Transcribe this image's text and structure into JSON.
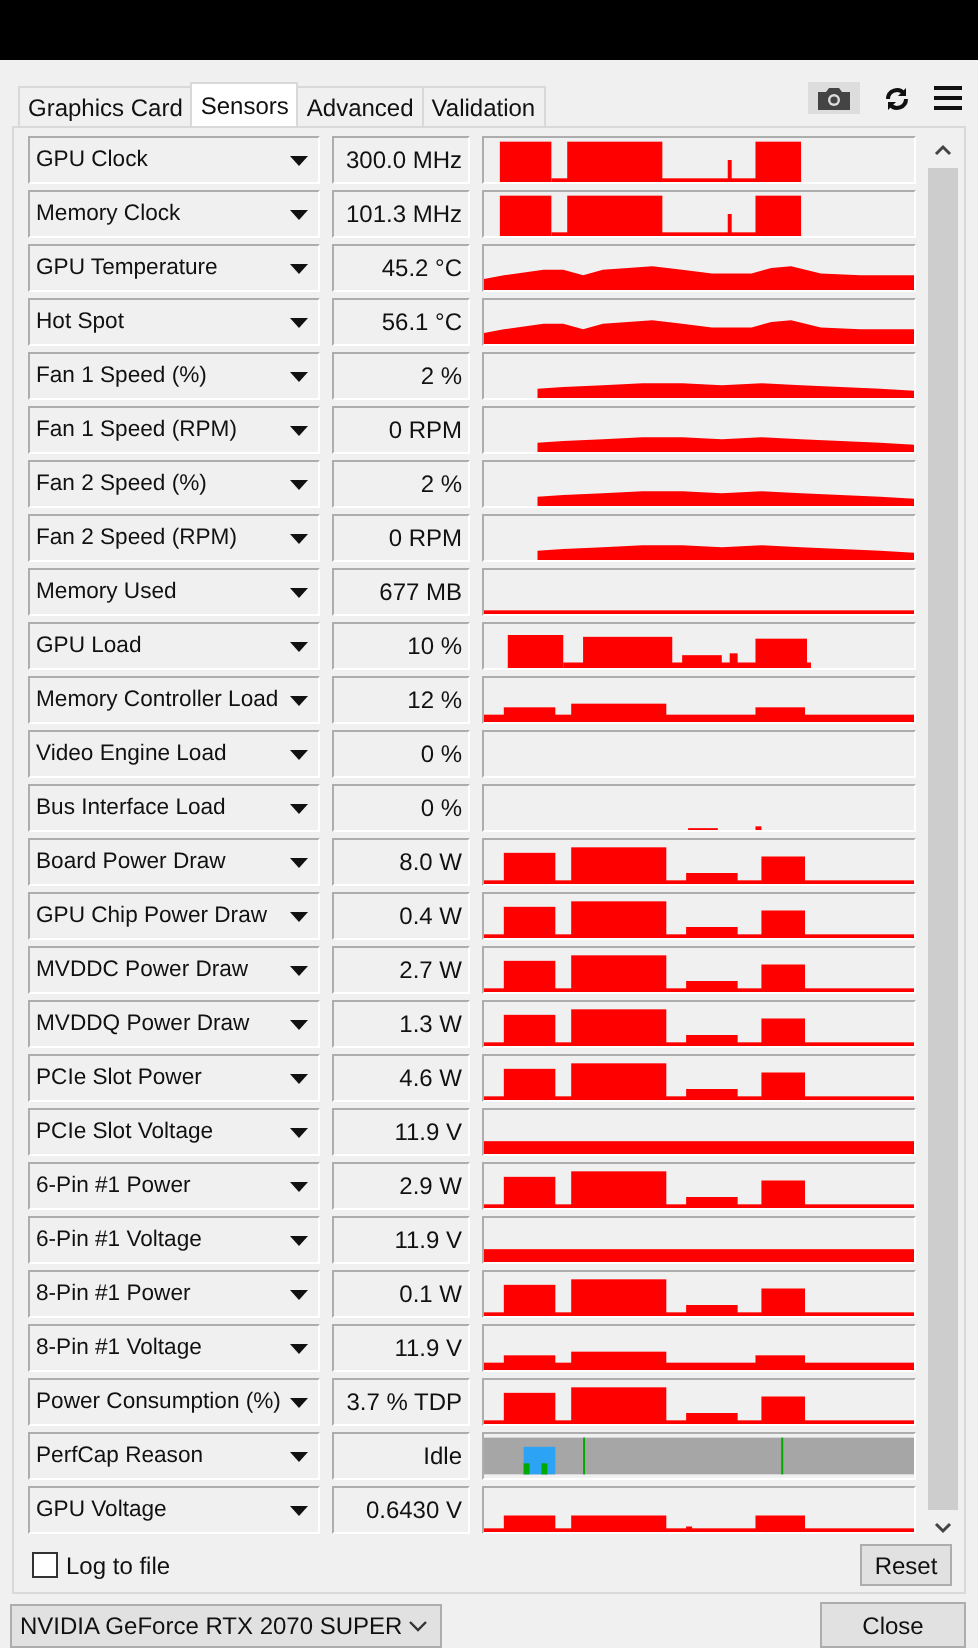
{
  "tabs": [
    {
      "label": "Graphics Card",
      "selected": false
    },
    {
      "label": "Sensors",
      "selected": true
    },
    {
      "label": "Advanced",
      "selected": false
    },
    {
      "label": "Validation",
      "selected": false
    }
  ],
  "sensors": [
    {
      "label": "GPU Clock",
      "value": "300.0 MHz",
      "kind": "clock"
    },
    {
      "label": "Memory Clock",
      "value": "101.3 MHz",
      "kind": "clock"
    },
    {
      "label": "GPU Temperature",
      "value": "45.2 °C",
      "kind": "temp"
    },
    {
      "label": "Hot Spot",
      "value": "56.1 °C",
      "kind": "temp"
    },
    {
      "label": "Fan 1 Speed (%)",
      "value": "2 %",
      "kind": "fan"
    },
    {
      "label": "Fan 1 Speed (RPM)",
      "value": "0 RPM",
      "kind": "fan"
    },
    {
      "label": "Fan 2 Speed (%)",
      "value": "2 %",
      "kind": "fan"
    },
    {
      "label": "Fan 2 Speed (RPM)",
      "value": "0 RPM",
      "kind": "fan"
    },
    {
      "label": "Memory Used",
      "value": "677 MB",
      "kind": "flat"
    },
    {
      "label": "GPU Load",
      "value": "10 %",
      "kind": "load"
    },
    {
      "label": "Memory Controller Load",
      "value": "12 %",
      "kind": "low"
    },
    {
      "label": "Video Engine Load",
      "value": "0 %",
      "kind": "empty"
    },
    {
      "label": "Bus Interface Load",
      "value": "0 %",
      "kind": "bus"
    },
    {
      "label": "Board Power Draw",
      "value": "8.0 W",
      "kind": "power"
    },
    {
      "label": "GPU Chip Power Draw",
      "value": "0.4 W",
      "kind": "power"
    },
    {
      "label": "MVDDC Power Draw",
      "value": "2.7 W",
      "kind": "power"
    },
    {
      "label": "MVDDQ Power Draw",
      "value": "1.3 W",
      "kind": "power"
    },
    {
      "label": "PCIe Slot Power",
      "value": "4.6 W",
      "kind": "power"
    },
    {
      "label": "PCIe Slot Voltage",
      "value": "11.9 V",
      "kind": "strip"
    },
    {
      "label": "6-Pin #1 Power",
      "value": "2.9 W",
      "kind": "power"
    },
    {
      "label": "6-Pin #1 Voltage",
      "value": "11.9 V",
      "kind": "strip"
    },
    {
      "label": "8-Pin #1 Power",
      "value": "0.1 W",
      "kind": "power"
    },
    {
      "label": "8-Pin #1 Voltage",
      "value": "11.9 V",
      "kind": "low"
    },
    {
      "label": "Power Consumption (%)",
      "value": "3.7 % TDP",
      "kind": "power"
    },
    {
      "label": "PerfCap Reason",
      "value": "Idle",
      "kind": "perfcap"
    },
    {
      "label": "GPU Voltage",
      "value": "0.6430 V",
      "kind": "volt"
    }
  ],
  "log_to_file": {
    "label": "Log to file",
    "checked": false
  },
  "reset_button": "Reset",
  "gpu_select": {
    "value": "NVIDIA GeForce RTX 2070 SUPER"
  },
  "close_button": "Close"
}
